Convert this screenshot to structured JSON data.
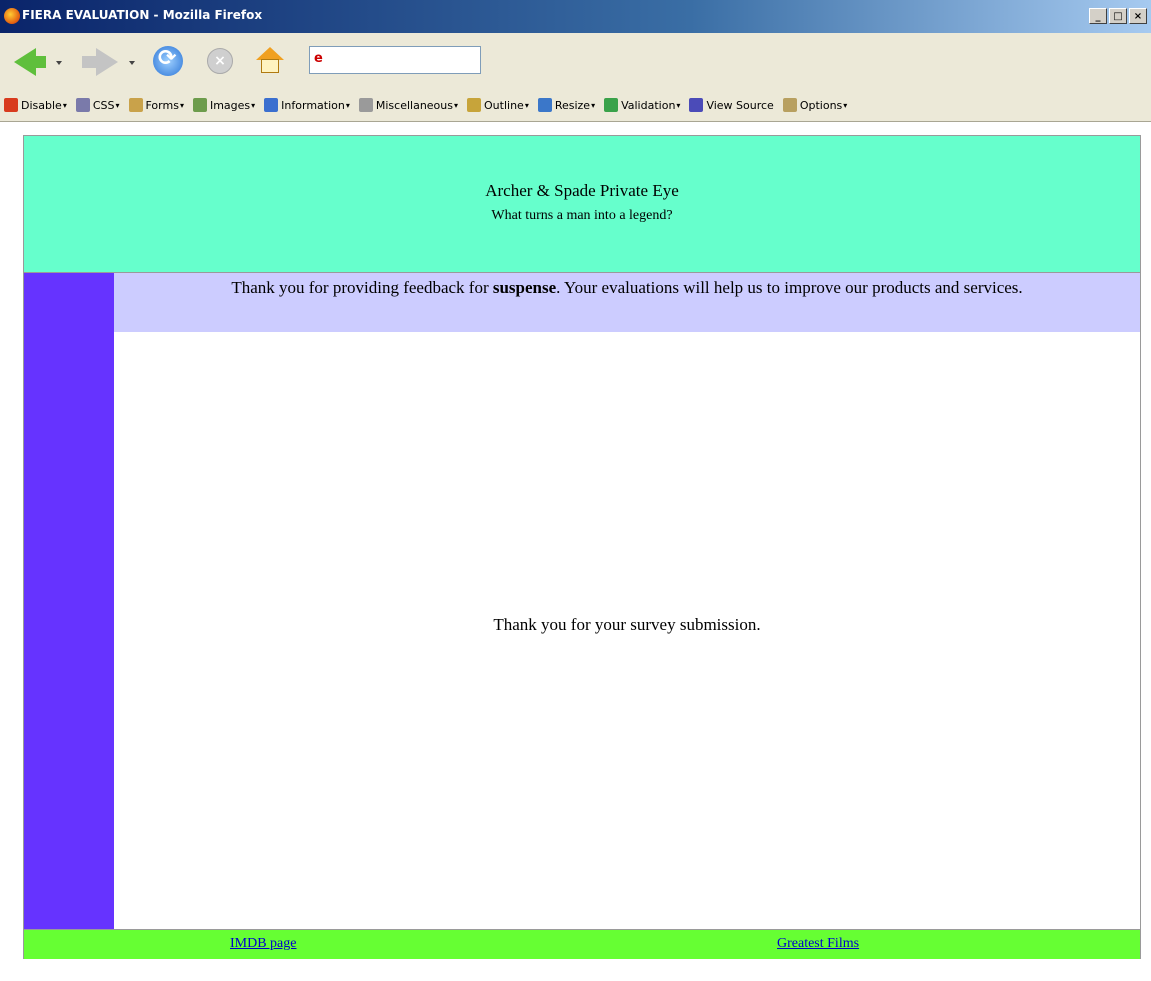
{
  "window": {
    "title": "FIERA EVALUATION - Mozilla Firefox",
    "controls": [
      "_",
      "□",
      "×"
    ]
  },
  "nav": {
    "back": "back",
    "forward": "forward",
    "reload": "reload",
    "stop": "stop",
    "home": "home",
    "url": ""
  },
  "devtoolbar": {
    "items": [
      {
        "label": "Disable",
        "icon": "red-x-icon",
        "color": "#d83b1e",
        "dropdown": true
      },
      {
        "label": "CSS",
        "icon": "css-icon",
        "color": "#7a7aaa",
        "dropdown": true
      },
      {
        "label": "Forms",
        "icon": "forms-icon",
        "color": "#c9a24a",
        "dropdown": true
      },
      {
        "label": "Images",
        "icon": "images-icon",
        "color": "#6d9c4c",
        "dropdown": true
      },
      {
        "label": "Information",
        "icon": "info-icon",
        "color": "#3b6fcf",
        "dropdown": true
      },
      {
        "label": "Miscellaneous",
        "icon": "wand-icon",
        "color": "#9a9a9a",
        "dropdown": true
      },
      {
        "label": "Outline",
        "icon": "pencil-icon",
        "color": "#c7a43a",
        "dropdown": true
      },
      {
        "label": "Resize",
        "icon": "resize-icon",
        "color": "#3b77c9",
        "dropdown": true
      },
      {
        "label": "Validation",
        "icon": "validation-icon",
        "color": "#3aa24a",
        "dropdown": true
      },
      {
        "label": "View Source",
        "icon": "view-source-icon",
        "color": "#4b4bb8",
        "dropdown": false
      },
      {
        "label": "Options",
        "icon": "options-icon",
        "color": "#b8a060",
        "dropdown": true
      }
    ]
  },
  "page": {
    "site_title": "Archer & Spade Private Eye",
    "tagline": "What turns a man into a legend?",
    "feedback_prefix": "Thank you for providing feedback for ",
    "feedback_subject": "suspense",
    "feedback_suffix": ". Your evaluations will help us to improve our products and services.",
    "confirmation": "Thank you for your survey submission.",
    "footer_links": [
      "IMDB page",
      "Greatest Films"
    ],
    "colors": {
      "header": "#66ffcc",
      "sidebar": "#6633ff",
      "feedback_bar": "#ccccff",
      "footer": "#66ff33"
    }
  }
}
